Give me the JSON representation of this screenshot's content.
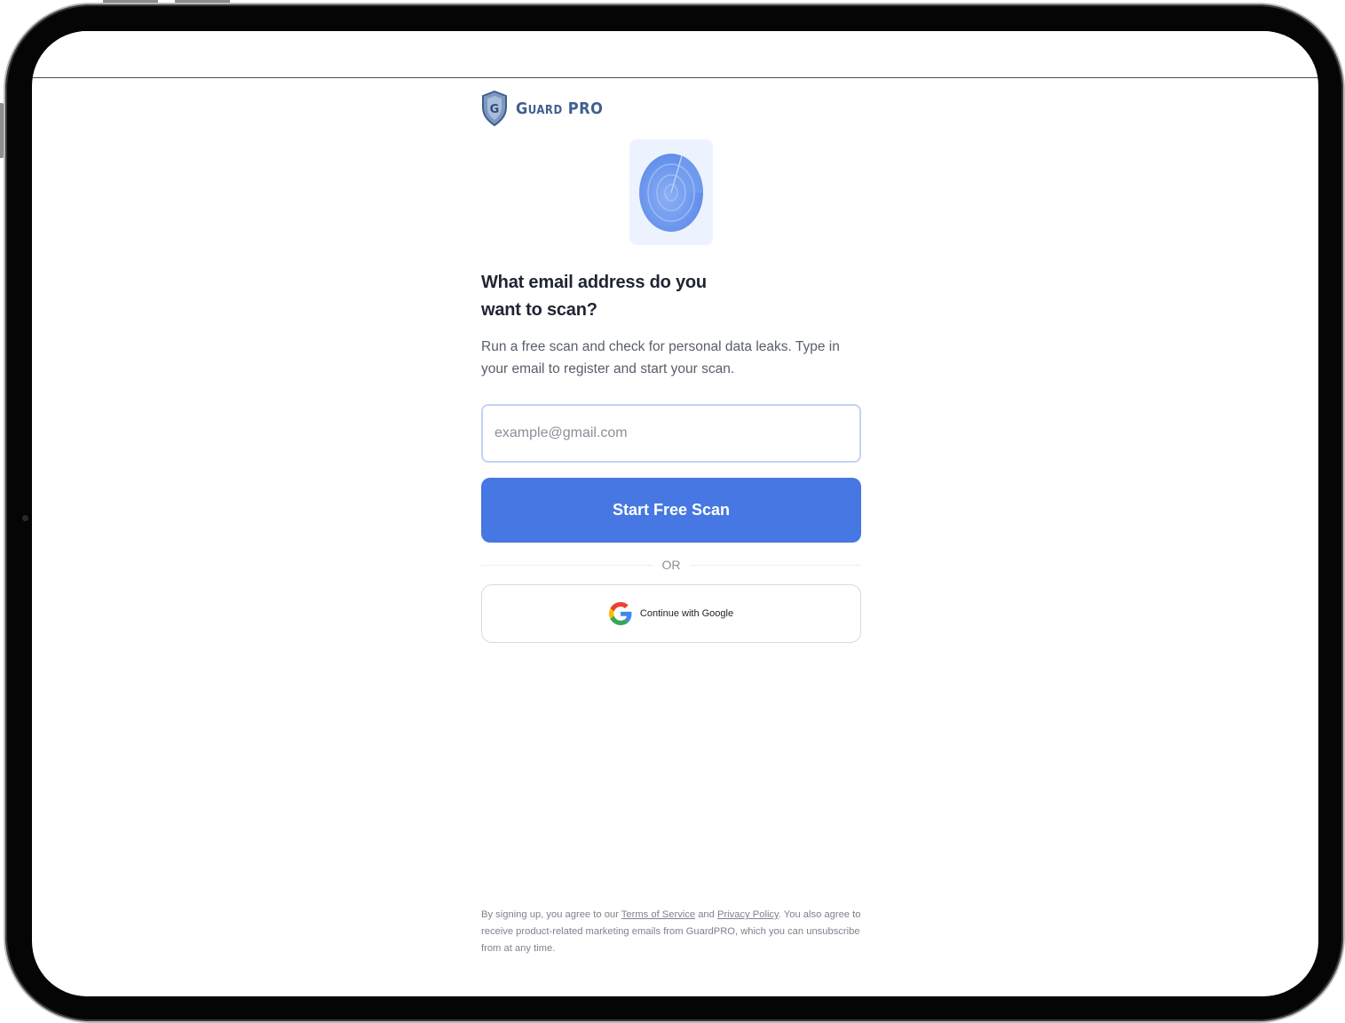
{
  "brand": {
    "name": "Guard PRO",
    "monogram": "G",
    "icon": "shield-icon",
    "color": "#3f5f8f"
  },
  "hero": {
    "icon": "radar-icon",
    "tile_color": "#edf3fe"
  },
  "form": {
    "heading": "What email address do you want to scan?",
    "subtitle": "Run a free scan and check for personal data leaks. Type in your email to register and start your scan.",
    "email_placeholder": "example@gmail.com",
    "email_value": "",
    "submit_label": "Start Free Scan",
    "submit_color": "#4677e2",
    "divider_label": "OR",
    "google_label": "Continue with Google",
    "google_icon": "google-icon"
  },
  "legal": {
    "prefix": "By signing up, you agree to our ",
    "terms_label": "Terms of Service",
    "and": " and ",
    "privacy_label": "Privacy Policy",
    "suffix": ". You also agree to receive product-related marketing emails from GuardPRO, which you can unsubscribe from at any time."
  }
}
